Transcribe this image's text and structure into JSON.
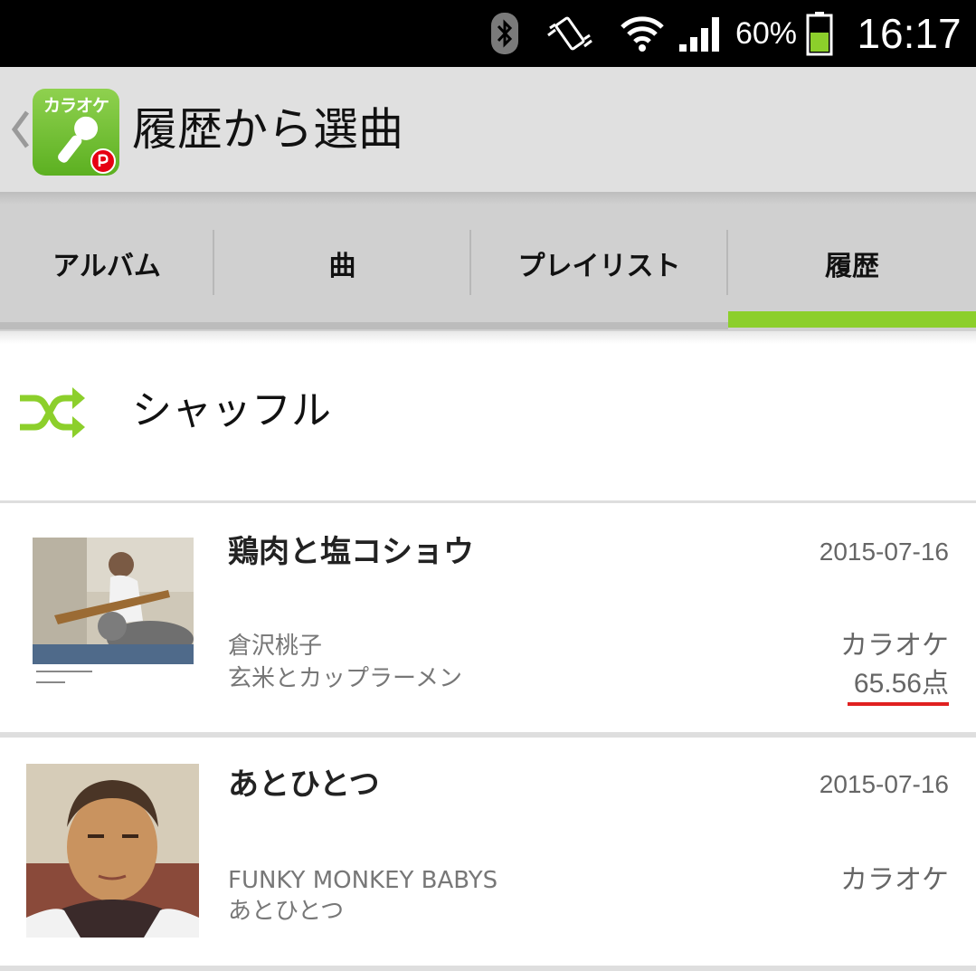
{
  "status_bar": {
    "battery_percent": "60%",
    "time": "16:17",
    "icons": [
      "bluetooth-icon",
      "vibrate-icon",
      "wifi-icon",
      "signal-icon",
      "battery-icon"
    ]
  },
  "action_bar": {
    "app_icon_text": "カラオケ",
    "title": "履歴から選曲"
  },
  "tabs": [
    {
      "label": "アルバム",
      "selected": false
    },
    {
      "label": "曲",
      "selected": false
    },
    {
      "label": "プレイリスト",
      "selected": false
    },
    {
      "label": "履歴",
      "selected": true
    }
  ],
  "shuffle": {
    "label": "シャッフル"
  },
  "history": [
    {
      "title": "鶏肉と塩コショウ",
      "date": "2015-07-16",
      "artist": "倉沢桃子",
      "album": "玄米とカップラーメン",
      "type": "カラオケ",
      "score": "65.56点"
    },
    {
      "title": "あとひとつ",
      "date": "2015-07-16",
      "artist": "FUNKY MONKEY BABYS",
      "album": "あとひとつ",
      "type": "カラオケ",
      "score": ""
    }
  ],
  "colors": {
    "accent": "#8ccf2b",
    "score_underline": "#e02020",
    "status_bar": "#000000",
    "action_bar": "#e0e0e0",
    "tab_bar": "#d0d0d0"
  }
}
